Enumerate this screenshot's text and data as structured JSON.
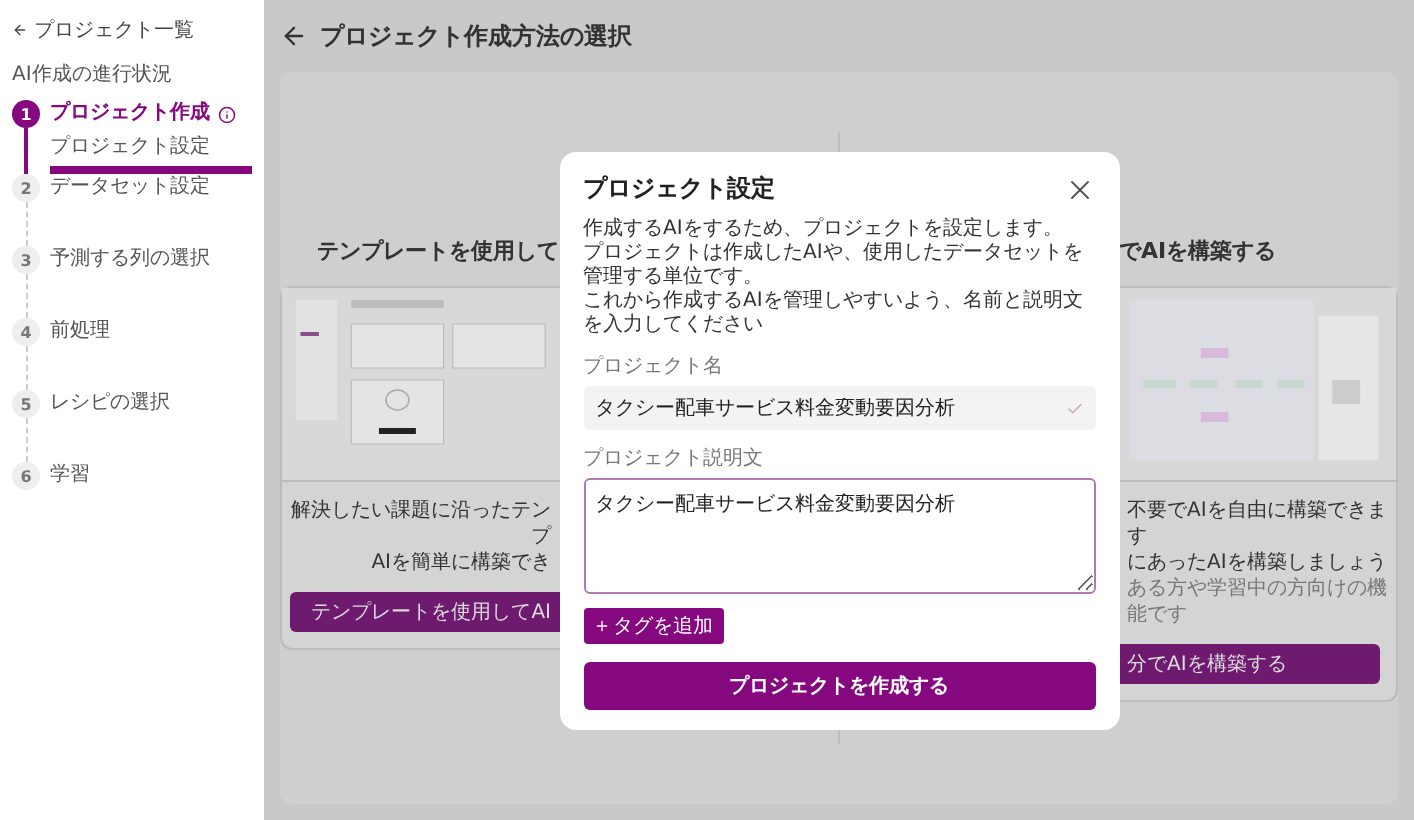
{
  "sidebar": {
    "back_link": "プロジェクト一覧",
    "section_title": "AI作成の進行状況",
    "steps": [
      {
        "number": "1",
        "label": "プロジェクト作成",
        "active": true,
        "children": [
          {
            "label": "プロジェクト設定",
            "selected": true
          }
        ]
      },
      {
        "number": "2",
        "label": "データセット設定",
        "active": false
      },
      {
        "number": "3",
        "label": "予測する列の選択",
        "active": false
      },
      {
        "number": "4",
        "label": "前処理",
        "active": false
      },
      {
        "number": "5",
        "label": "レシピの選択",
        "active": false
      },
      {
        "number": "6",
        "label": "学習",
        "active": false
      }
    ]
  },
  "page": {
    "title": "プロジェクト作成方法の選択"
  },
  "options": [
    {
      "title": "テンプレートを使用して",
      "lines": [
        {
          "text": "解決したい課題に沿ったテンプ",
          "muted": false
        },
        {
          "text": "AIを簡単に構築でき",
          "muted": false
        }
      ],
      "button": "テンプレートを使用してAI"
    },
    {
      "title": "でAIを構築する",
      "lines": [
        {
          "text": "不要でAIを自由に構築できます",
          "muted": false
        },
        {
          "text": "にあったAIを構築しましょう",
          "muted": false
        },
        {
          "text": "ある方や学習中の方向けの機能です",
          "muted": true
        }
      ],
      "button": "分でAIを構築する"
    }
  ],
  "modal": {
    "title": "プロジェクト設定",
    "description": [
      "作成するAIをするため、プロジェクトを設定します。",
      "プロジェクトは作成したAIや、使用したデータセットを管理する単位です。",
      "これから作成するAIを管理しやすいよう、名前と説明文を入力してください"
    ],
    "name_label": "プロジェクト名",
    "name_value": "タクシー配車サービス料金変動要因分析",
    "name_valid": true,
    "description_label": "プロジェクト説明文",
    "description_value": "タクシー配車サービス料金変動要因分析",
    "tag_button": "タグを追加",
    "submit_button": "プロジェクトを作成する"
  }
}
